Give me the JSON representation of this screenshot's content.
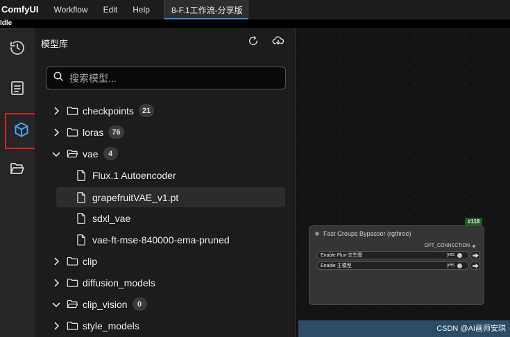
{
  "menubar": {
    "brand": "ComfyUI",
    "items": [
      "Workflow",
      "Edit",
      "Help"
    ],
    "workflow_tab": "8-F.1工作流-分享版"
  },
  "status": "Idle",
  "rail": {
    "items": [
      {
        "icon": "history-icon"
      },
      {
        "icon": "queue-list-icon"
      },
      {
        "icon": "model-library-cube-icon",
        "active": true,
        "highlight_color": "#e02020"
      },
      {
        "icon": "folder-open-icon"
      }
    ]
  },
  "panel": {
    "title": "模型库",
    "search_placeholder": "搜索模型...",
    "tree": [
      {
        "label": "checkpoints",
        "count": "21",
        "expanded": false
      },
      {
        "label": "loras",
        "count": "76",
        "expanded": false
      },
      {
        "label": "vae",
        "count": "4",
        "expanded": true
      },
      {
        "label": "Flux.1 Autoencoder",
        "leaf": true
      },
      {
        "label": "grapefruitVAE_v1.pt",
        "leaf": true,
        "selected": true
      },
      {
        "label": "sdxl_vae",
        "leaf": true
      },
      {
        "label": "vae-ft-mse-840000-ema-pruned",
        "leaf": true
      },
      {
        "label": "clip",
        "expanded": false
      },
      {
        "label": "diffusion_models",
        "expanded": false
      },
      {
        "label": "clip_vision",
        "count": "0",
        "expanded": true
      },
      {
        "label": "style_models",
        "expanded": false
      }
    ]
  },
  "canvas": {
    "node_id": "#118",
    "node_title": "Fast Groups Bypasser (rgthree)",
    "output_label": "OPT_CONNECTION",
    "toggles": [
      {
        "label": "Enable Flux-文生图",
        "value": "yes"
      },
      {
        "label": "Enable 主模型",
        "value": "yes"
      }
    ]
  },
  "watermark": "CSDN @AI画师安琪"
}
